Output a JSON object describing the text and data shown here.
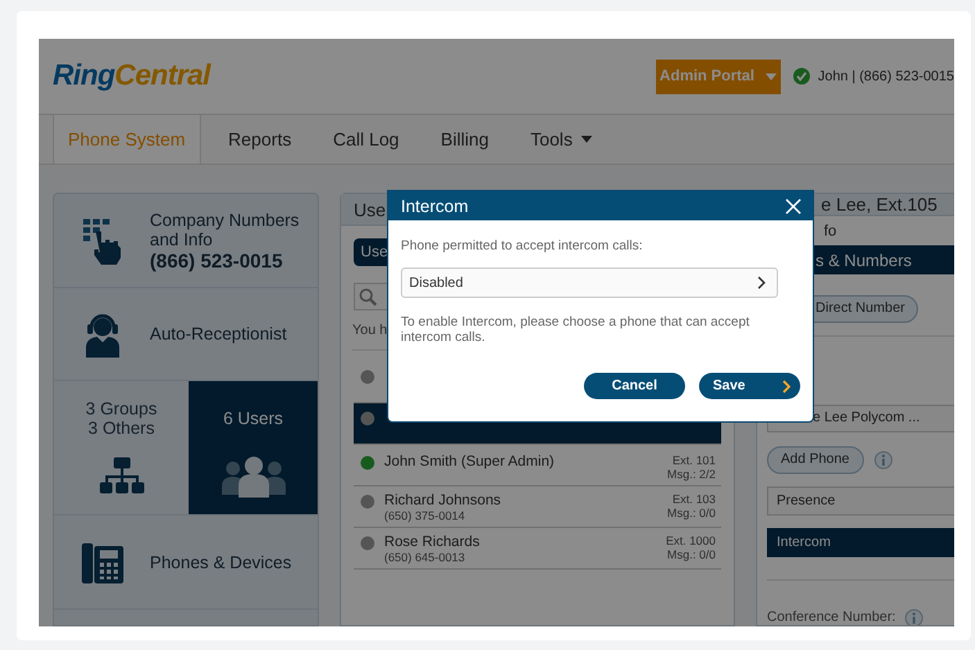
{
  "header": {
    "logo": [
      "Ring",
      "Central"
    ],
    "admin_button": "Admin Portal",
    "user": "John | (866) 523-0015",
    "online": true
  },
  "nav": [
    {
      "label": "Phone System",
      "selected": true,
      "menu": false
    },
    {
      "label": "Reports",
      "selected": false,
      "menu": false
    },
    {
      "label": "Call Log",
      "selected": false,
      "menu": false
    },
    {
      "label": "Billing",
      "selected": false,
      "menu": false
    },
    {
      "label": "Tools",
      "selected": false,
      "menu": true
    }
  ],
  "tiles": [
    {
      "kind": "company",
      "title": "Company Numbers and Info",
      "number": "(866) 523-0015"
    },
    {
      "kind": "receptionist",
      "title": "Auto-Receptionist"
    },
    {
      "kind": "split",
      "items": [
        {
          "kind": "groups",
          "lines": [
            "3 Groups",
            "3 Others"
          ],
          "selected": false
        },
        {
          "kind": "users",
          "lines": [
            "6 Users"
          ],
          "selected": true
        }
      ]
    },
    {
      "kind": "phones",
      "title": "Phones & Devices"
    }
  ],
  "users_panel": {
    "title": "Use",
    "tab": "Use",
    "note": "You h",
    "rows": [
      {
        "online": false,
        "selected": false
      },
      {
        "online": false,
        "selected": true
      },
      {
        "name": "John Smith (Super Admin)",
        "ext": "Ext. 101",
        "msg": "Msg.: 2/2",
        "online": true,
        "selected": false
      },
      {
        "name": "Richard Johnsons",
        "phone": "(650) 375-0014",
        "ext": "Ext. 103",
        "msg": "Msg.: 0/0",
        "online": false,
        "selected": false
      },
      {
        "name": "Rose Richards",
        "phone": "(650) 645-0013",
        "ext": "Ext. 1000",
        "msg": "Msg.: 0/0",
        "online": false,
        "selected": false
      }
    ]
  },
  "detail_panel": {
    "title": "e Lee, Ext.105",
    "sections": [
      {
        "label": "fo",
        "selected": false
      },
      {
        "label": "s & Numbers",
        "selected": true
      }
    ],
    "direct_button": "Direct Number",
    "phone_field": "e Lee Polycom ...",
    "add_phone": "Add Phone",
    "menu": [
      {
        "label": "Presence",
        "selected": false
      },
      {
        "label": "Intercom",
        "selected": true
      }
    ],
    "conference_label": "Conference Number:"
  },
  "dialog": {
    "title": "Intercom",
    "label": "Phone permitted to accept intercom calls:",
    "value": "Disabled",
    "help": "To enable Intercom, please choose a phone that can accept intercom calls.",
    "buttons": [
      {
        "label": "Cancel",
        "kind": "secondary"
      },
      {
        "label": "Save",
        "kind": "primary"
      }
    ]
  }
}
